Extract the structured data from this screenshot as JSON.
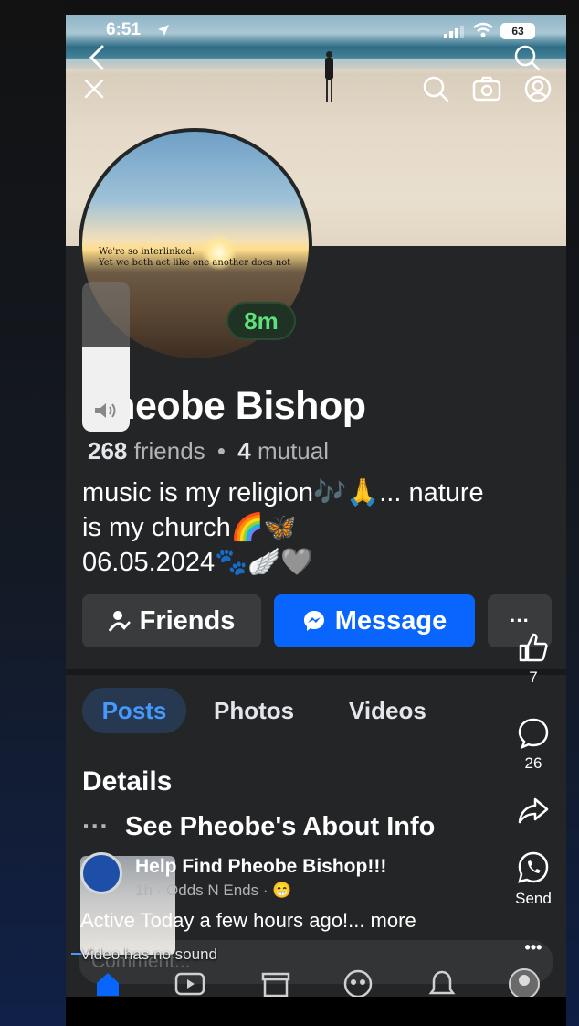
{
  "status_bar": {
    "time": "6:51",
    "battery": "63"
  },
  "profile": {
    "name": "Pheobe Bishop",
    "name_visible": "heobe Bishop",
    "avatar_quote_line1": "We're so interlinked.",
    "avatar_quote_line2": "Yet we both act like one another does not",
    "story_badge": "8m",
    "friends_count": "268",
    "friends_label": "friends",
    "separator": "•",
    "mutual_count": "4",
    "mutual_label": "mutual",
    "bio_line1": "music is my religion🎶🙏... nature",
    "bio_line2": "is my church🌈🦋",
    "bio_line3": "06.05.2024🐾🪽🩶"
  },
  "actions": {
    "friends_label": "Friends",
    "message_label": "Message",
    "more_label": "···"
  },
  "tabs": [
    {
      "label": "Posts",
      "active": true
    },
    {
      "label": "Photos",
      "active": false
    },
    {
      "label": "Videos",
      "active": false
    }
  ],
  "details": {
    "title": "Details",
    "about_dots": "···",
    "about_label": "See Pheobe's About Info"
  },
  "side_actions": {
    "like_count": "7",
    "comment_count": "26",
    "send_label": "Send",
    "more_label": "•••"
  },
  "post": {
    "title": "Help Find Pheobe Bishop!!!",
    "meta": "1h · Odds N Ends · 😁",
    "text": "Active Today a few hours ago!... more",
    "comment_placeholder": "Comment...",
    "overlay_note": "Video has no sound"
  },
  "colors": {
    "accent": "#0866ff",
    "story_green": "#5fe07a",
    "background": "#242526",
    "active_tab_bg": "#263951",
    "active_tab_text": "#4599ff"
  },
  "icons": {
    "back": "chevron-left-icon",
    "close": "close-icon",
    "search": "search-icon",
    "camera": "camera-icon",
    "profile": "person-icon",
    "like": "thumbs-up-icon",
    "comment": "comment-icon",
    "share": "share-icon",
    "whatsapp": "whatsapp-icon"
  }
}
